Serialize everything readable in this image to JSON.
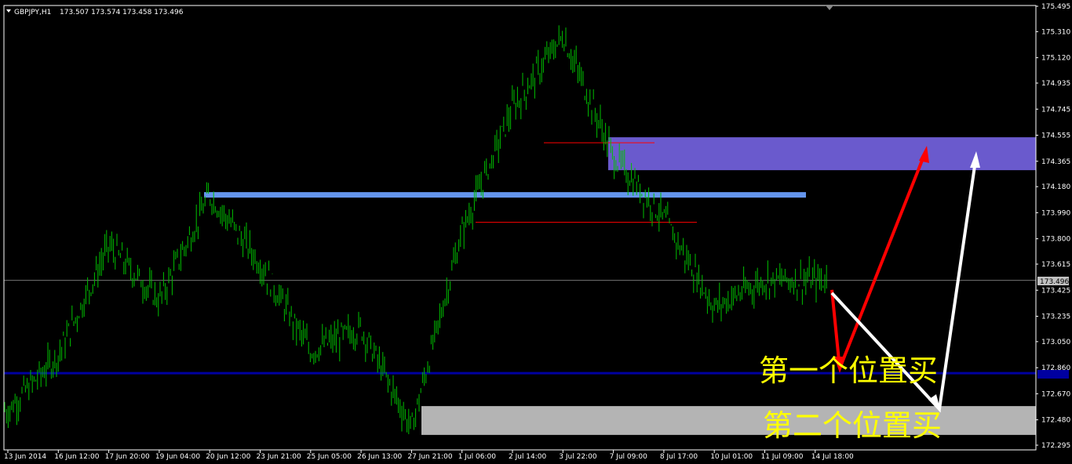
{
  "header": {
    "symbol": "GBPJPY,H1",
    "ohlc": "173.507 173.574 173.458 173.496"
  },
  "colors": {
    "background": "#000000",
    "frame": "#ffffff",
    "candle": "#00c000",
    "resistance_zone": "#6a5acd",
    "support_zone": "#b4b4b4",
    "level_line_light_blue": "#6495ed",
    "level_line_dark_blue": "#0000a0",
    "red_level": "#ff0000",
    "annotation_text": "#ffff00",
    "bid_line": "#c0c0c0"
  },
  "chart_data": {
    "type": "candlestick",
    "ylim": [
      172.295,
      175.495
    ],
    "y_ticks": [
      "175.495",
      "175.310",
      "175.120",
      "174.935",
      "174.745",
      "174.555",
      "174.365",
      "174.180",
      "173.990",
      "173.800",
      "173.615",
      "173.425",
      "173.235",
      "173.050",
      "172.860",
      "172.670",
      "172.480",
      "172.295"
    ],
    "x_ticks": [
      "13 Jun 2014",
      "16 Jun 12:00",
      "17 Jun 20:00",
      "19 Jun 04:00",
      "20 Jun 12:00",
      "23 Jun 21:00",
      "25 Jun 05:00",
      "26 Jun 13:00",
      "27 Jun 21:00",
      "1 Jul 06:00",
      "2 Jul 14:00",
      "3 Jul 22:00",
      "7 Jul 09:00",
      "8 Jul 17:00",
      "10 Jul 01:00",
      "11 Jul 09:00",
      "14 Jul 18:00"
    ],
    "current_price": "173.496",
    "price_path": [
      [
        "13 Jun 2014",
        172.55
      ],
      [
        "16 Jun 12:00",
        172.95
      ],
      [
        "17 Jun 20:00",
        173.75
      ],
      [
        "19 Jun 04:00",
        173.35
      ],
      [
        "20 Jun 12:00",
        174.12
      ],
      [
        "23 Jun 21:00",
        173.62
      ],
      [
        "25 Jun 05:00",
        172.98
      ],
      [
        "26 Jun 13:00",
        173.15
      ],
      [
        "27 Jun 21:00",
        172.42
      ],
      [
        "1 Jul 06:00",
        173.85
      ],
      [
        "2 Jul 14:00",
        174.75
      ],
      [
        "3 Jul 22:00",
        175.28
      ],
      [
        "7 Jul 09:00",
        174.4
      ],
      [
        "8 Jul 17:00",
        173.95
      ],
      [
        "10 Jul 01:00",
        173.3
      ],
      [
        "11 Jul 09:00",
        173.5
      ],
      [
        "14 Jul 18:00",
        173.496
      ]
    ],
    "zones": [
      {
        "from": 174.3,
        "to": 174.54
      },
      {
        "from": 172.37,
        "to": 172.58
      }
    ],
    "levels": [
      174.12,
      172.82,
      174.5,
      173.92
    ],
    "annotations": [
      "第一个位置买",
      "第二个位置买"
    ]
  }
}
